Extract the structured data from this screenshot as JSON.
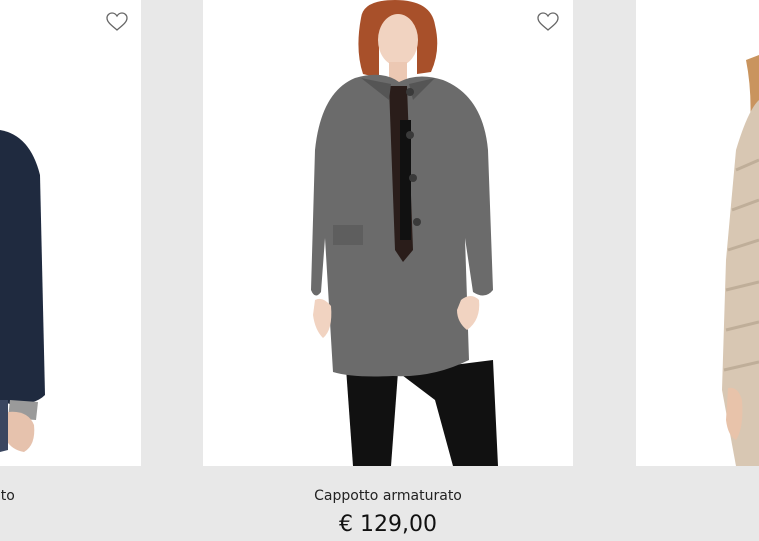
{
  "products": [
    {
      "name": "Cappotto fiancato",
      "visible_name": "ancato"
    },
    {
      "name": "Cappotto armaturato",
      "price": "€ 129,00"
    }
  ],
  "icons": {
    "wishlist": "heart-outline-icon"
  },
  "colors": {
    "page_bg": "#e8e8e8",
    "card_bg": "#ffffff",
    "heart_stroke": "#666666",
    "coat_grey": "#6b6b6b",
    "coat_navy": "#1f2a3f"
  }
}
